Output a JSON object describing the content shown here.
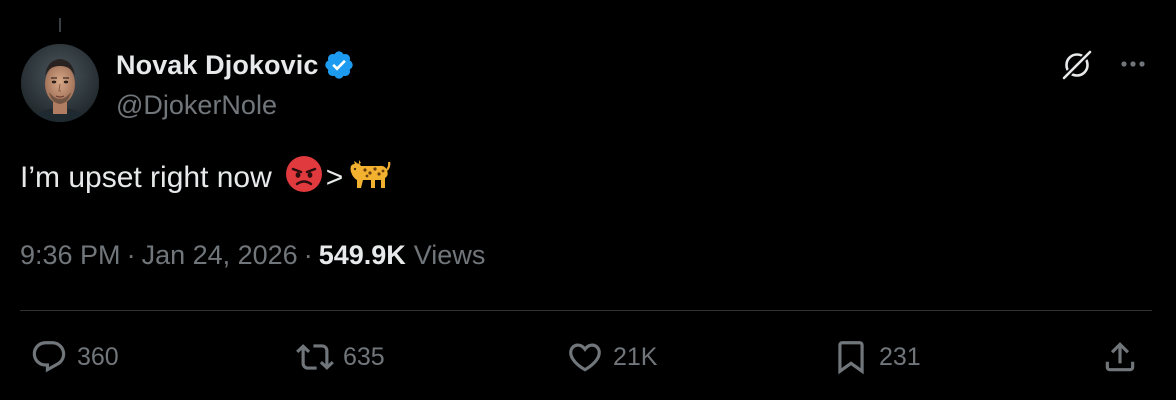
{
  "author": {
    "display_name": "Novak Djokovic",
    "handle": "@DjokerNole",
    "verified": true
  },
  "tweet": {
    "text": "I’m upset right now",
    "emojis": [
      "angry-face",
      "greater-than",
      "leopard"
    ],
    "gt_symbol": ">"
  },
  "meta": {
    "time": "9:36 PM",
    "separator": "·",
    "date": "Jan 24, 2026",
    "views_count": "549.9K",
    "views_label": "Views"
  },
  "actions": {
    "replies": "360",
    "reposts": "635",
    "likes": "21K",
    "bookmarks": "231"
  },
  "colors": {
    "background": "#000000",
    "text_primary": "#e7e9ea",
    "text_secondary": "#71767b",
    "divider": "#2f3336",
    "verified_badge": "#1d9bf0"
  }
}
